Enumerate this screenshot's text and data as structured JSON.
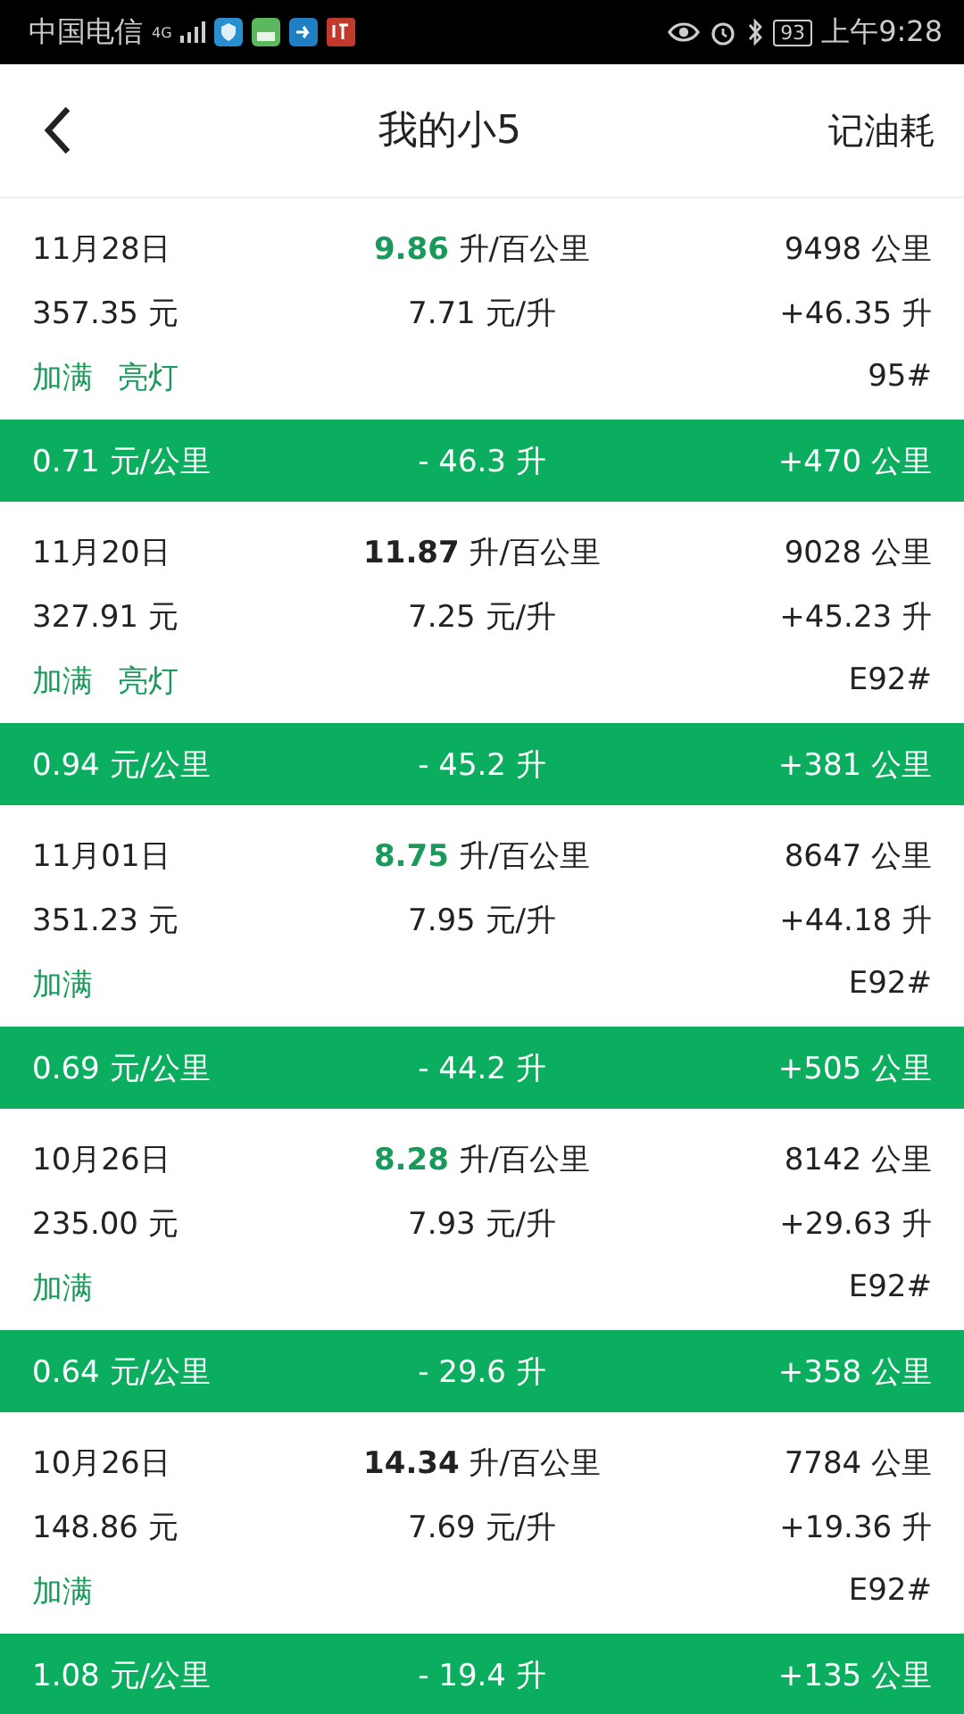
{
  "status_bar": {
    "carrier": "中国电信",
    "network": "4G",
    "battery": "93",
    "time": "上午9:28"
  },
  "header": {
    "title": "我的小5",
    "action": "记油耗"
  },
  "records": [
    {
      "date": "11月28日",
      "consumption": "9.86",
      "consumption_unit": "升/百公里",
      "good": true,
      "odometer": "9498 公里",
      "cost": "357.35 元",
      "price": "7.71 元/升",
      "volume": "+46.35 升",
      "tags": [
        "加满",
        "亮灯"
      ],
      "fuel": "95#",
      "per_km": "0.71 元/公里",
      "used": "- 46.3 升",
      "distance": "+470 公里"
    },
    {
      "date": "11月20日",
      "consumption": "11.87",
      "consumption_unit": "升/百公里",
      "good": false,
      "odometer": "9028 公里",
      "cost": "327.91 元",
      "price": "7.25 元/升",
      "volume": "+45.23 升",
      "tags": [
        "加满",
        "亮灯"
      ],
      "fuel": "E92#",
      "per_km": "0.94 元/公里",
      "used": "- 45.2 升",
      "distance": "+381 公里"
    },
    {
      "date": "11月01日",
      "consumption": "8.75",
      "consumption_unit": "升/百公里",
      "good": true,
      "odometer": "8647 公里",
      "cost": "351.23 元",
      "price": "7.95 元/升",
      "volume": "+44.18 升",
      "tags": [
        "加满"
      ],
      "fuel": "E92#",
      "per_km": "0.69 元/公里",
      "used": "- 44.2 升",
      "distance": "+505 公里"
    },
    {
      "date": "10月26日",
      "consumption": "8.28",
      "consumption_unit": "升/百公里",
      "good": true,
      "odometer": "8142 公里",
      "cost": "235.00 元",
      "price": "7.93 元/升",
      "volume": "+29.63 升",
      "tags": [
        "加满"
      ],
      "fuel": "E92#",
      "per_km": "0.64 元/公里",
      "used": "- 29.6 升",
      "distance": "+358 公里"
    },
    {
      "date": "10月26日",
      "consumption": "14.34",
      "consumption_unit": "升/百公里",
      "good": false,
      "odometer": "7784 公里",
      "cost": "148.86 元",
      "price": "7.69 元/升",
      "volume": "+19.36 升",
      "tags": [
        "加满"
      ],
      "fuel": "E92#",
      "per_km": "1.08 元/公里",
      "used": "- 19.4 升",
      "distance": "+135 公里"
    }
  ]
}
